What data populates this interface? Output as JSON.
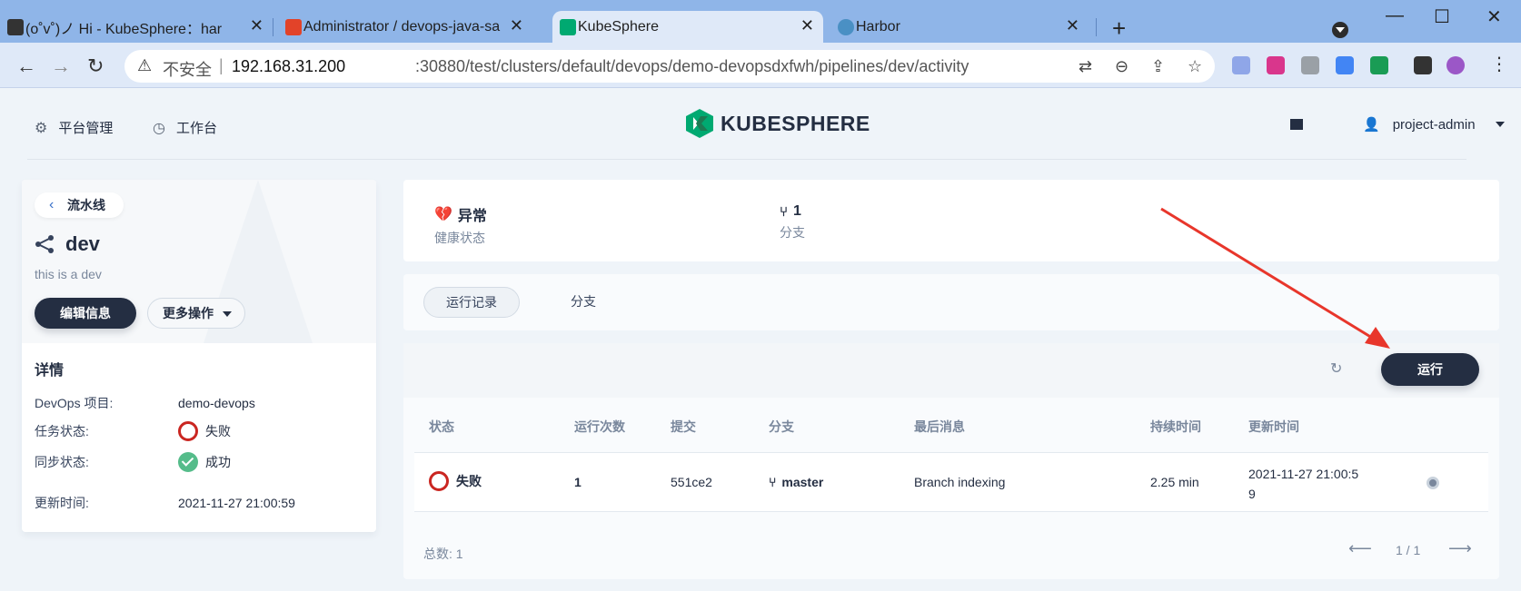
{
  "browser": {
    "tabs": [
      {
        "title": "(o˚v˚)ノ Hi - KubeSphere：har",
        "favicon_color": "#333333"
      },
      {
        "title": "Administrator / devops-java-sa",
        "favicon_color": "#e24329"
      },
      {
        "title": "KubeSphere",
        "favicon_color": "#00a971"
      },
      {
        "title": "Harbor",
        "favicon_color": "#4a90c4"
      }
    ],
    "active_tab": 2,
    "address": {
      "security_label": "不安全",
      "host": "192.168.31.200",
      "path": ":30880/test/clusters/default/devops/demo-devopsdxfwh/pipelines/dev/activity"
    }
  },
  "header": {
    "platform_label": "平台管理",
    "workbench_label": "工作台",
    "logo_text": "KUBESPHERE",
    "user_name": "project-admin"
  },
  "sidebar": {
    "back_label": "流水线",
    "pipeline_name": "dev",
    "description": "this is a dev",
    "edit_button": "编辑信息",
    "more_button": "更多操作",
    "details_title": "详情",
    "details": [
      {
        "key": "DevOps 项目:",
        "value": "demo-devops",
        "status": "none"
      },
      {
        "key": "任务状态:",
        "value": "失败",
        "status": "fail"
      },
      {
        "key": "同步状态:",
        "value": "成功",
        "status": "ok"
      },
      {
        "key": "更新时间:",
        "value": "2021-11-27 21:00:59",
        "status": "none"
      }
    ]
  },
  "summary": {
    "health_value": "异常",
    "health_label": "健康状态",
    "branch_value": "1",
    "branch_label": "分支"
  },
  "tabs": {
    "runs": "运行记录",
    "branches": "分支"
  },
  "table": {
    "run_button": "运行",
    "columns": [
      "状态",
      "运行次数",
      "提交",
      "分支",
      "最后消息",
      "持续时间",
      "更新时间"
    ],
    "rows": [
      {
        "status": "失败",
        "run": "1",
        "commit": "551ce2",
        "branch": "master",
        "message": "Branch indexing",
        "duration": "2.25 min",
        "updated_line1": "2021-11-27 21:00:5",
        "updated_line2": "9"
      }
    ],
    "total_label": "总数:  1",
    "page_label": "1 / 1"
  },
  "colors": {
    "primary_dark": "#242e42",
    "fail": "#ca2621",
    "success": "#55bc8a",
    "annotation_arrow": "#e8362b"
  }
}
